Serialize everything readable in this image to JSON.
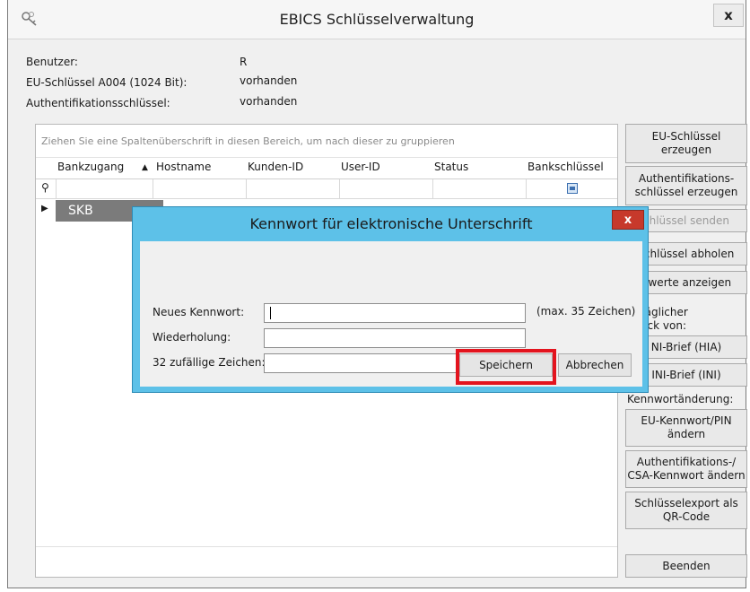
{
  "window": {
    "title": "EBICS Schlüsselverwaltung",
    "close_glyph": "x",
    "icon": "keys-icon"
  },
  "info": {
    "rows": [
      {
        "label": "Benutzer:",
        "value": "R"
      },
      {
        "label": "EU-Schlüssel A004 (1024 Bit):",
        "value": "vorhanden"
      },
      {
        "label": "Authentifikationsschlüssel:",
        "value": "vorhanden"
      }
    ]
  },
  "grid": {
    "group_hint": "Ziehen Sie eine Spaltenüberschrift in diesen Bereich, um nach dieser zu gruppieren",
    "sort_glyph": "▲",
    "columns": [
      "Bankzugang",
      "Hostname",
      "Kunden-ID",
      "User-ID",
      "Status",
      "Bankschlüssel"
    ],
    "filter_pin": "⚲",
    "row_indicator": "▶",
    "rows": [
      {
        "Bankzugang": "SKB"
      }
    ]
  },
  "side": {
    "buttons": [
      "EU-Schlüssel erzeugen",
      "Authentifikations-schlüssel erzeugen",
      "chlüssel senden",
      "schlüssel abholen",
      "hwerte anzeigen"
    ],
    "label_1": "träglicher",
    "label_2": "ruck von:",
    "buttons_2": [
      "NI-Brief (HIA)",
      "INI-Brief (INI)"
    ],
    "label_3": "Kennwortänderung:",
    "buttons_3": [
      "EU-Kennwort/PIN ändern",
      "Authentifikations-/ CSA-Kennwort ändern",
      "Schlüsselexport als QR-Code"
    ],
    "quit": "Beenden"
  },
  "dialog": {
    "title": "Kennwort für elektronische Unterschrift",
    "close_glyph": "x",
    "fields": [
      {
        "label": "Neues Kennwort:",
        "value": ""
      },
      {
        "label": "Wiederholung:",
        "value": ""
      },
      {
        "label": "32 zufällige Zeichen:",
        "value": ""
      }
    ],
    "max_hint": "(max. 35 Zeichen)",
    "save": "Speichern",
    "cancel": "Abbrechen",
    "highlight_color": "#e3141e"
  }
}
